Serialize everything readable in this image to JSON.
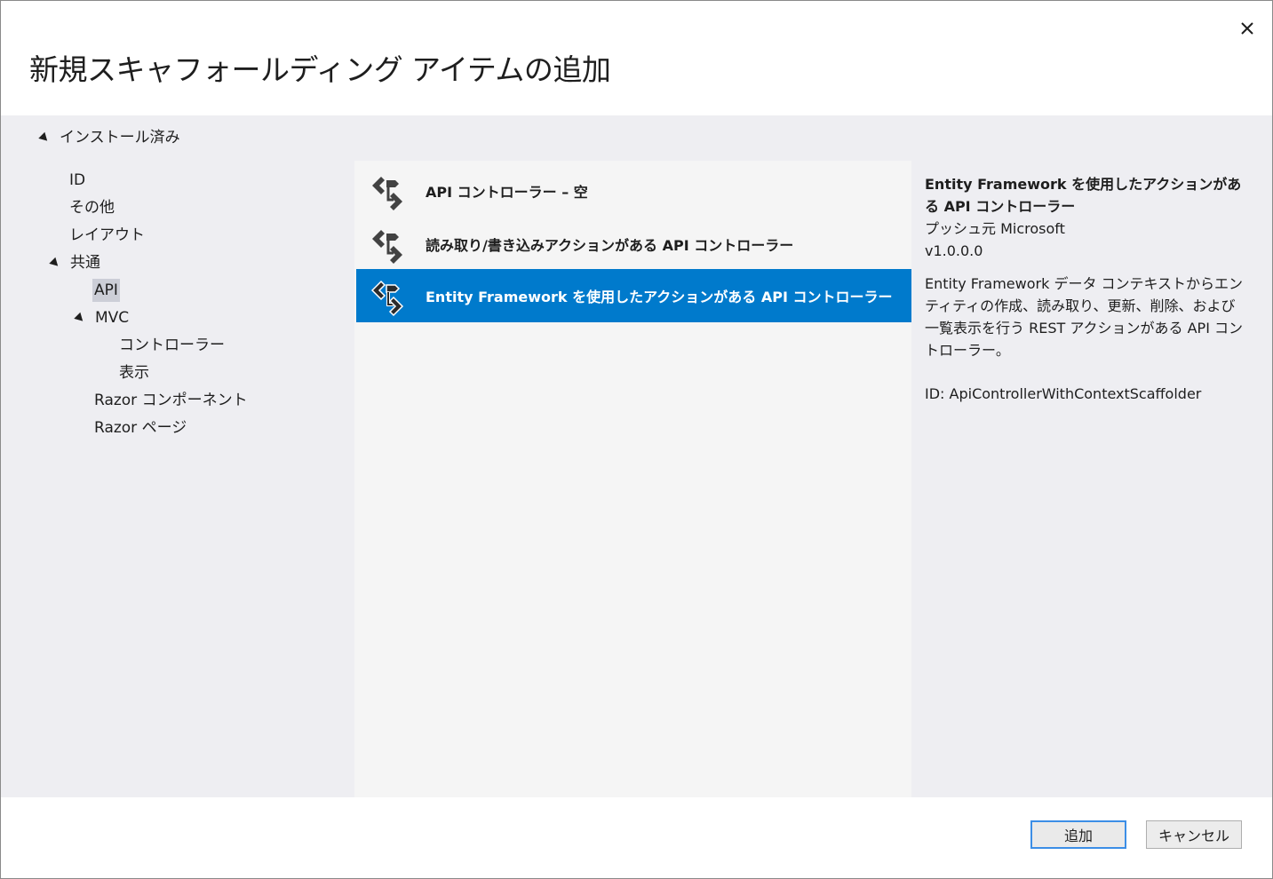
{
  "dialog": {
    "title": "新規スキャフォールディング アイテムの追加"
  },
  "tree": {
    "root": "インストール済み",
    "items": [
      {
        "label": "ID"
      },
      {
        "label": "その他"
      },
      {
        "label": "レイアウト"
      },
      {
        "label": "共通"
      },
      {
        "label": "API"
      },
      {
        "label": "MVC"
      },
      {
        "label": "コントローラー"
      },
      {
        "label": "表示"
      },
      {
        "label": "Razor コンポーネント"
      },
      {
        "label": "Razor ページ"
      }
    ],
    "selected": "API"
  },
  "list": {
    "items": [
      {
        "label": "API コントローラー – 空",
        "icon": "api-controller-icon"
      },
      {
        "label": "読み取り/書き込みアクションがある API コントローラー",
        "icon": "api-controller-icon"
      },
      {
        "label": "Entity Framework を使用したアクションがある API コントローラー",
        "icon": "api-controller-icon"
      }
    ],
    "selected_index": 2
  },
  "details": {
    "title": "Entity Framework を使用したアクションがある API コントローラー",
    "publisher": "プッシュ元 Microsoft",
    "version": "v1.0.0.0",
    "description": "Entity Framework データ コンテキストからエンティティの作成、読み取り、更新、削除、および一覧表示を行う REST アクションがある API コントローラー。",
    "id": "ID: ApiControllerWithContextScaffolder"
  },
  "buttons": {
    "add": "追加",
    "cancel": "キャンセル"
  },
  "colors": {
    "accent": "#007acc",
    "content_bg": "#eeeef2",
    "list_bg": "#f5f5f5"
  }
}
